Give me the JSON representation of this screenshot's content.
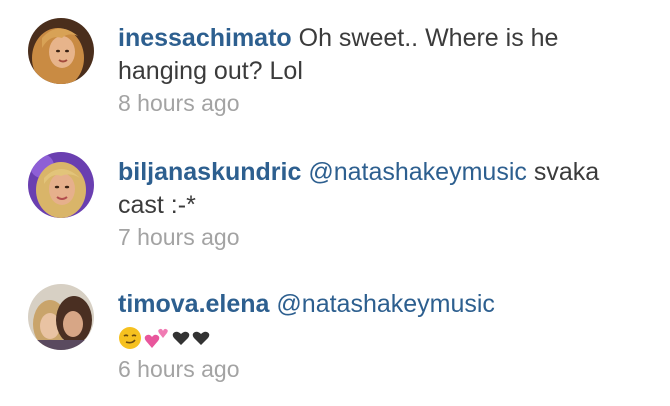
{
  "comments": [
    {
      "username": "inessachimato",
      "text": " Oh sweet.. Where is he hanging out? Lol",
      "time": "8 hours ago",
      "avatar_icon": "profile-photo-blonde"
    },
    {
      "username": "biljanaskundric",
      "mention": "@natashakeymusic",
      "text": " svaka cast :-*",
      "time": "7 hours ago",
      "avatar_icon": "profile-photo-blonde-purple"
    },
    {
      "username": "timova.elena",
      "mention": "@natashakeymusic",
      "emojis": [
        "smirk-face-emoji",
        "two-hearts-emoji",
        "black-heart-emoji",
        "black-heart-emoji"
      ],
      "time": "6 hours ago",
      "avatar_icon": "profile-photo-two-people"
    }
  ],
  "colors": {
    "username": "#2d5f8f",
    "text": "#3b3b3b",
    "timestamp": "#a3a3a3"
  }
}
